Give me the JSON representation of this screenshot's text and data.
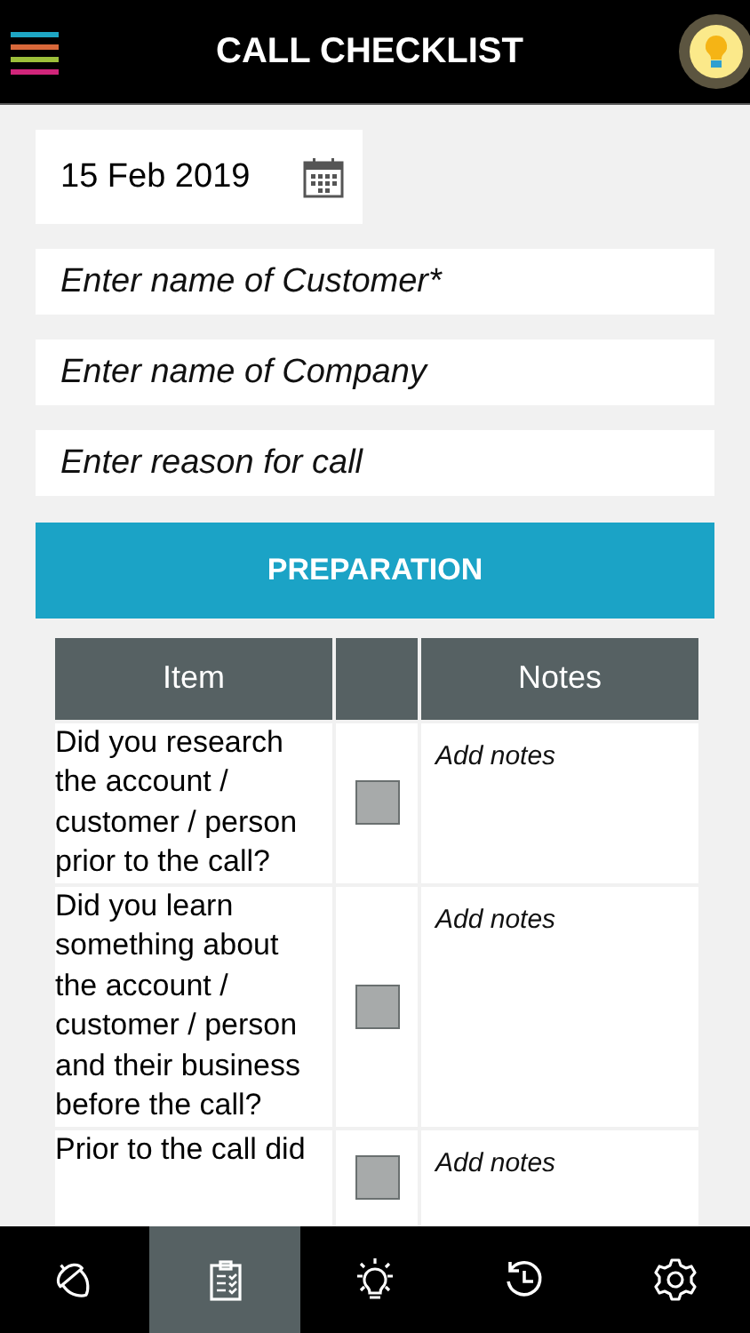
{
  "header": {
    "title": "CALL CHECKLIST"
  },
  "date": {
    "value": "15 Feb 2019"
  },
  "fields": [
    {
      "placeholder": "Enter name of Customer*"
    },
    {
      "placeholder": "Enter name of Company"
    },
    {
      "placeholder": "Enter reason for call"
    }
  ],
  "section_button": {
    "label": "PREPARATION"
  },
  "table": {
    "columns": [
      "Item",
      "",
      "Notes"
    ],
    "rows": [
      {
        "item": "Did you research the account / customer / person prior to the call?",
        "checked": false,
        "notes_placeholder": "Add notes"
      },
      {
        "item": "Did you learn something about the account / customer / person and their business before the call?",
        "checked": false,
        "notes_placeholder": "Add notes"
      },
      {
        "item": "Prior to the call did",
        "checked": false,
        "notes_placeholder": "Add notes"
      }
    ]
  },
  "tab_bar": [
    {
      "kind": "acorn",
      "selected": false
    },
    {
      "kind": "checklist",
      "selected": true
    },
    {
      "kind": "bulb",
      "selected": false
    },
    {
      "kind": "history",
      "selected": false
    },
    {
      "kind": "settings",
      "selected": false
    }
  ]
}
